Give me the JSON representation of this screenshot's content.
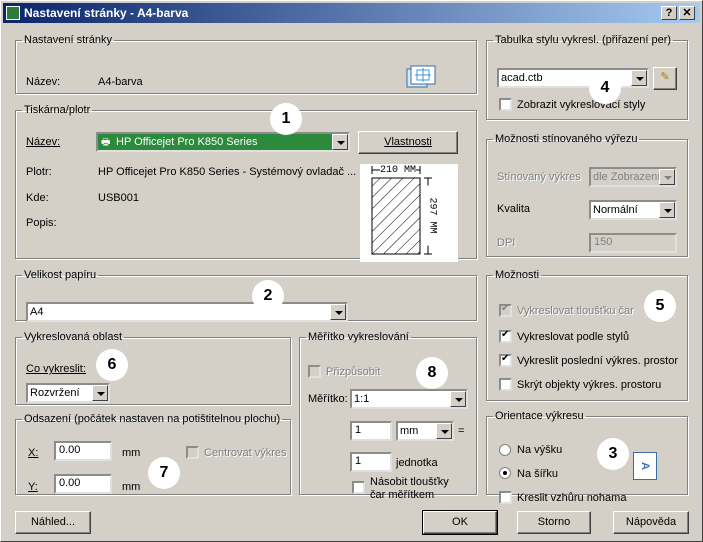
{
  "window": {
    "title": "Nastavení stránky - A4-barva",
    "help_btn": "?",
    "close_btn": "✕"
  },
  "page_setup": {
    "legend": "Nastavení stránky",
    "name_label": "Název:",
    "name_value": "A4-barva"
  },
  "printer": {
    "legend": "Tiskárna/plotr",
    "name_label": "Název:",
    "name_value": "HP Officejet Pro K850 Series",
    "properties_btn": "Vlastnosti",
    "plotter_label": "Plotr:",
    "plotter_value": "HP Officejet Pro K850 Series - Systémový ovladač ...",
    "where_label": "Kde:",
    "where_value": "USB001",
    "desc_label": "Popis:",
    "desc_value": "",
    "preview_width": "210 MM",
    "preview_height": "297 MM"
  },
  "paper_size": {
    "legend": "Velikost papíru",
    "value": "A4"
  },
  "plot_area": {
    "legend": "Vykreslovaná oblast",
    "what_label": "Co vykreslit:",
    "what_value": "Rozvržení"
  },
  "offset": {
    "legend": "Odsazení (počátek nastaven na potištitelnou plochu)",
    "x_label": "X:",
    "x_value": "0.00",
    "x_unit": "mm",
    "y_label": "Y:",
    "y_value": "0.00",
    "y_unit": "mm",
    "center_label": "Centrovat výkres"
  },
  "scale": {
    "legend": "Měřítko vykreslování",
    "fit_label": "Přizpůsobit",
    "scale_label": "Měřítko:",
    "scale_value": "1:1",
    "num_value": "1",
    "unit_value": "mm",
    "equals": "=",
    "unit_num_value": "1",
    "unit_label": "jednotka",
    "lineweight_label_1": "Násobit tloušťky",
    "lineweight_label_2": "čar měřítkem"
  },
  "style_table": {
    "legend": "Tabulka stylu vykresl. (přiřazení per)",
    "value": "acad.ctb",
    "display_label": "Zobrazit vykreslovací styly"
  },
  "shaded": {
    "legend": "Možnosti stínovaného výřezu",
    "shaded_label": "Stínovaný výkres",
    "shaded_value": "dle Zobrazení",
    "quality_label": "Kvalita",
    "quality_value": "Normální",
    "dpi_label": "DPI",
    "dpi_value": "150"
  },
  "options": {
    "legend": "Možnosti",
    "lineweights": "Vykreslovat tloušťku čar",
    "plot_styles": "Vykreslovat podle stylů",
    "paperspace_last": "Vykreslit poslední výkres. prostor",
    "hide_objects": "Skrýt objekty výkres. prostoru"
  },
  "orientation": {
    "legend": "Orientace výkresu",
    "portrait": "Na výšku",
    "landscape": "Na šířku",
    "upside_down": "Kreslit vzhůru nohama",
    "preview_glyph": "A"
  },
  "buttons": {
    "preview": "Náhled...",
    "ok": "OK",
    "cancel": "Storno",
    "help": "Nápověda"
  },
  "callouts": [
    "1",
    "2",
    "3",
    "4",
    "5",
    "6",
    "7",
    "8"
  ]
}
